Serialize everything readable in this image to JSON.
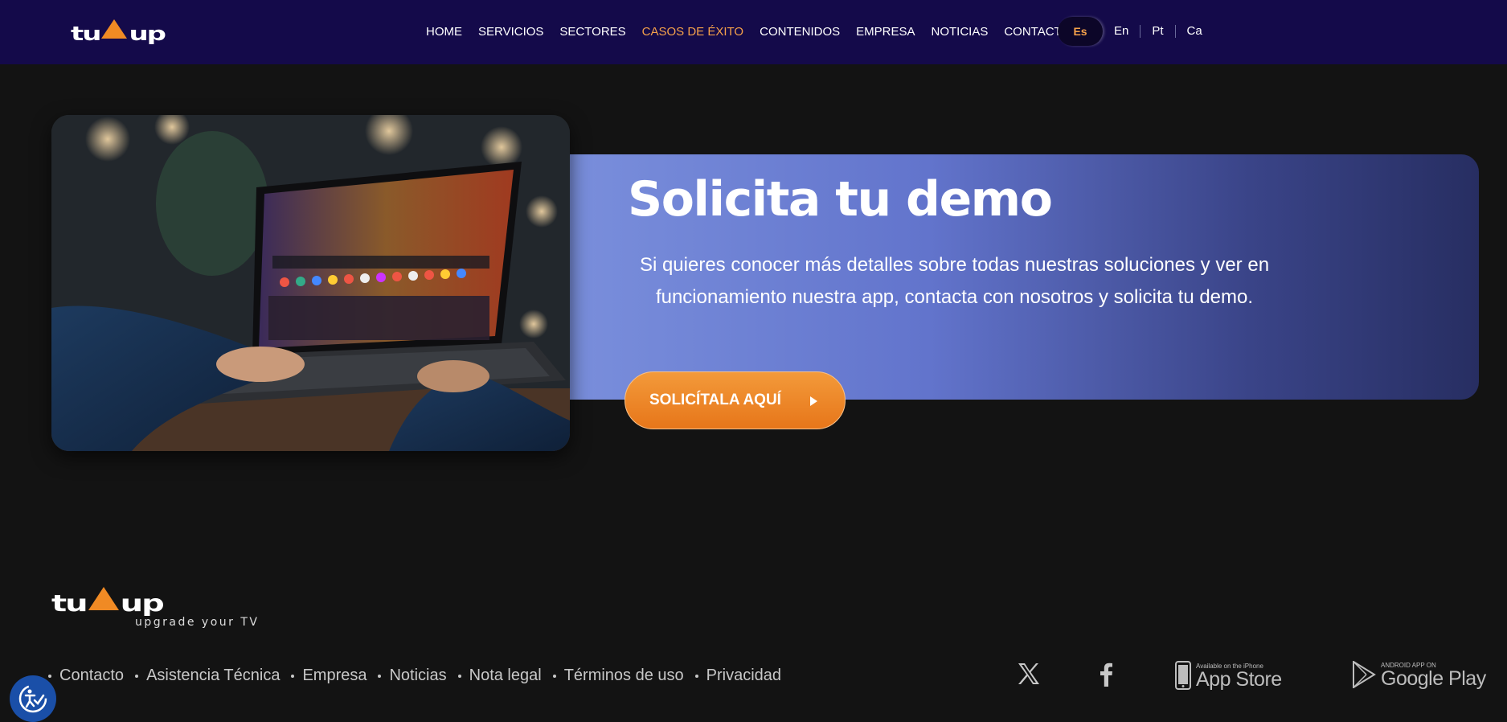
{
  "brand": {
    "name": "tu",
    "name_suffix": "up",
    "tagline": "upgrade your TV",
    "accent": "#f08a24"
  },
  "nav": {
    "items": [
      {
        "label": "HOME"
      },
      {
        "label": "SERVICIOS"
      },
      {
        "label": "SECTORES"
      },
      {
        "label": "CASOS DE ÉXITO",
        "active": true
      },
      {
        "label": "CONTENIDOS"
      },
      {
        "label": "EMPRESA"
      },
      {
        "label": "NOTICIAS"
      },
      {
        "label": "CONTACTO"
      }
    ],
    "active_color": "#f5a14a"
  },
  "languages": {
    "active": "Es",
    "options": [
      "En",
      "Pt",
      "Ca"
    ]
  },
  "hero": {
    "title": "Solicita tu demo",
    "description": "Si quieres conocer más detalles sobre todas nuestras soluciones y ver en funcionamiento nuestra app, contacta con nosotros y solicita tu demo.",
    "cta_label": "SOLICÍTALA AQUÍ",
    "image_icon": "laptop-streaming-photo"
  },
  "footer": {
    "links": [
      "Contacto",
      "Asistencia Técnica",
      "Empresa",
      "Noticias",
      "Nota legal",
      "Términos de uso",
      "Privacidad"
    ],
    "social": [
      "x-icon",
      "facebook-icon"
    ],
    "app_store": {
      "small": "Available on the iPhone",
      "big": "App Store"
    },
    "google_play": {
      "small": "ANDROID APP ON",
      "big": "Google Play"
    }
  },
  "colors": {
    "header_bg": "#140a4a",
    "page_bg": "#131313",
    "cta": "#ee8528",
    "banner_start": "#7a8fdc",
    "banner_end": "#272e62"
  }
}
